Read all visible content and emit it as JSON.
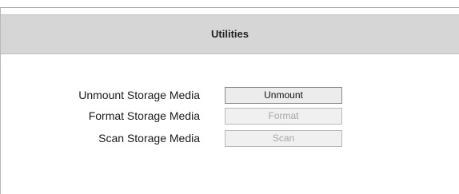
{
  "header": {
    "title": "Utilities"
  },
  "rows": [
    {
      "label": "Unmount Storage Media",
      "button_label": "Unmount",
      "enabled": true
    },
    {
      "label": "Format Storage Media",
      "button_label": "Format",
      "enabled": false
    },
    {
      "label": "Scan Storage Media",
      "button_label": "Scan",
      "enabled": false
    }
  ]
}
